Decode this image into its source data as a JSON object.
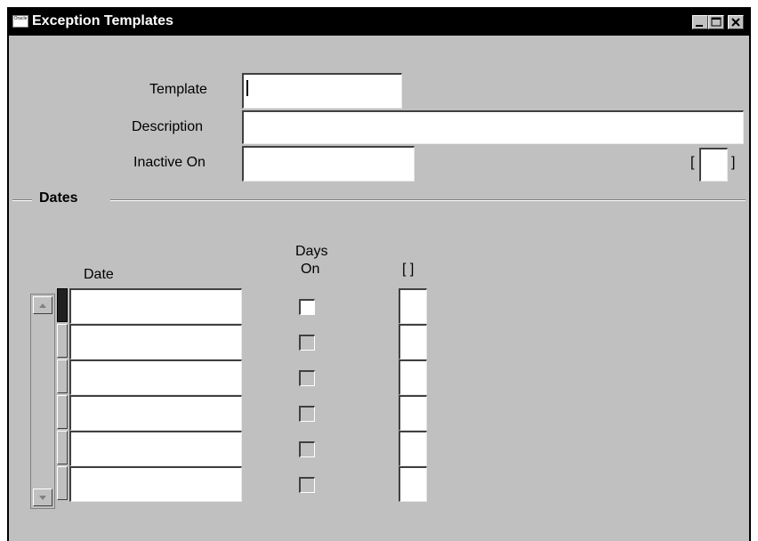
{
  "window": {
    "title": "Exception Templates",
    "app_icon_text": "Oracle"
  },
  "form": {
    "template_label": "Template",
    "template_value": "",
    "description_label": "Description",
    "description_value": "",
    "inactive_on_label": "Inactive On",
    "inactive_on_value": "",
    "flex_open": "[",
    "flex_close": "]"
  },
  "dates": {
    "section_title": "Dates",
    "date_header": "Date",
    "days_on_header_line1": "Days",
    "days_on_header_line2": "On",
    "flex_header": "[ ]",
    "rows": [
      {
        "date": "",
        "days_on": false
      },
      {
        "date": "",
        "days_on": false
      },
      {
        "date": "",
        "days_on": false
      },
      {
        "date": "",
        "days_on": false
      },
      {
        "date": "",
        "days_on": false
      },
      {
        "date": "",
        "days_on": false
      }
    ]
  },
  "colors": {
    "canvas": "#c0c0c0",
    "titlebar": "#000000",
    "field": "#ffffff"
  },
  "icons": [
    "oracle-app-icon",
    "minimize-icon",
    "maximize-icon",
    "close-icon",
    "scroll-up-icon",
    "scroll-down-icon"
  ]
}
